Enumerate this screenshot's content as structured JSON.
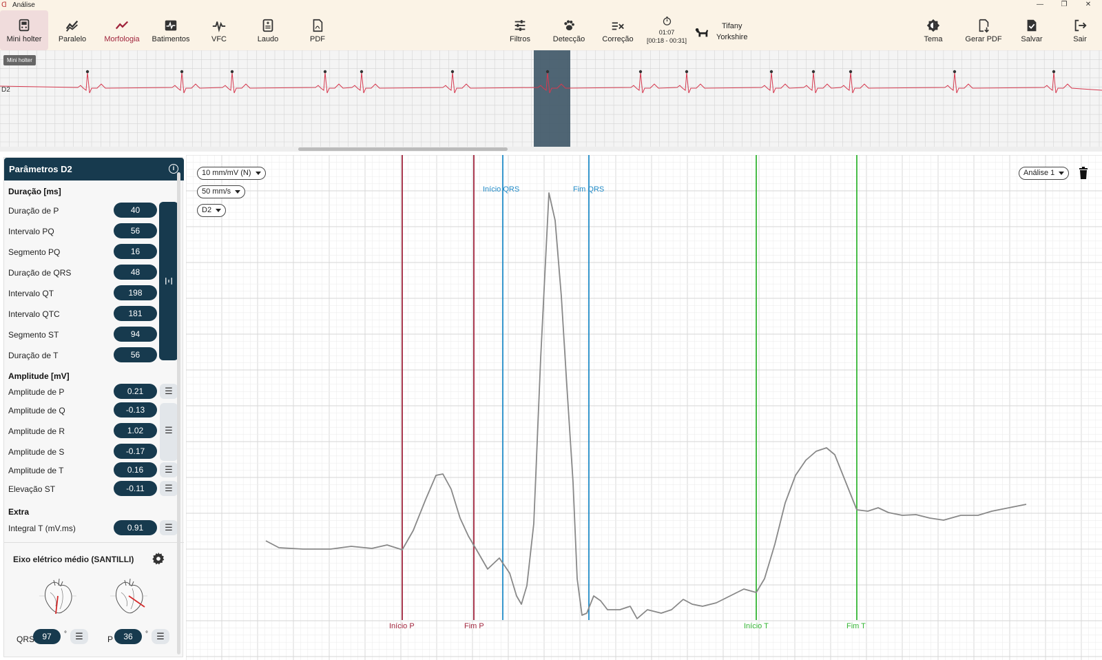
{
  "window": {
    "title": "Análise"
  },
  "toolbar": {
    "left": [
      {
        "label": "Mini holter",
        "icon": "mini-holter-icon"
      },
      {
        "label": "Paralelo",
        "icon": "paralelo-icon"
      },
      {
        "label": "Morfologia",
        "icon": "morfologia-icon"
      },
      {
        "label": "Batimentos",
        "icon": "batimentos-icon"
      },
      {
        "label": "VFC",
        "icon": "vfc-icon"
      },
      {
        "label": "Laudo",
        "icon": "laudo-icon"
      },
      {
        "label": "PDF",
        "icon": "pdf-icon"
      }
    ],
    "center": [
      {
        "label": "Filtros",
        "icon": "filtros-icon"
      },
      {
        "label": "Detecção",
        "icon": "paw-icon"
      },
      {
        "label": "Correção",
        "icon": "correcao-icon"
      }
    ],
    "time": {
      "current": "01:07",
      "range": "[00:18 - 00:31]"
    },
    "patient": {
      "name": "Tifany",
      "breed": "Yorkshire"
    },
    "right": [
      {
        "label": "Tema",
        "icon": "tema-icon"
      },
      {
        "label": "Gerar PDF",
        "icon": "gerar-pdf-icon"
      },
      {
        "label": "Salvar",
        "icon": "salvar-icon"
      },
      {
        "label": "Sair",
        "icon": "sair-icon"
      }
    ]
  },
  "strip": {
    "badge": "Mini holter",
    "lead": "D2"
  },
  "panel": {
    "title": "Parâmetros D2",
    "duracao": {
      "title": "Duração [ms]",
      "rows": [
        {
          "label": "Duração de P",
          "value": "40"
        },
        {
          "label": "Intervalo PQ",
          "value": "56"
        },
        {
          "label": "Segmento PQ",
          "value": "16"
        },
        {
          "label": "Duração de QRS",
          "value": "48"
        },
        {
          "label": "Intervalo QT",
          "value": "198"
        },
        {
          "label": "Intervalo QTC",
          "value": "181"
        },
        {
          "label": "Segmento ST",
          "value": "94"
        },
        {
          "label": "Duração de T",
          "value": "56"
        }
      ]
    },
    "amplitude": {
      "title": "Amplitude [mV]",
      "rows": [
        {
          "label": "Amplitude de P",
          "value": "0.21"
        },
        {
          "label": "Amplitude de Q",
          "value": "-0.13"
        },
        {
          "label": "Amplitude de R",
          "value": "1.02"
        },
        {
          "label": "Amplitude de S",
          "value": "-0.17"
        },
        {
          "label": "Amplitude de T",
          "value": "0.16"
        },
        {
          "label": "Elevação ST",
          "value": "-0.11"
        }
      ]
    },
    "extra": {
      "title": "Extra",
      "rows": [
        {
          "label": "Integral T (mV.ms)",
          "value": "0.91"
        }
      ]
    },
    "eixo": {
      "title": "Eixo elétrico médio (SANTILLI)",
      "qrs_label": "QRS",
      "qrs_value": "97",
      "p_label": "P",
      "p_value": "36",
      "deg": "°"
    }
  },
  "main": {
    "dropdowns": {
      "gain": "10 mm/mV (N)",
      "speed": "50 mm/s",
      "lead": "D2"
    },
    "analysis": "Análise 1",
    "markers": {
      "inicio_p": "Início P",
      "fim_p": "Fim P",
      "inicio_qrs": "Início QRS",
      "fim_qrs": "Fim QRS",
      "inicio_t": "Início T",
      "fim_t": "Fim T"
    },
    "colors": {
      "p": "#a0243c",
      "qrs": "#1f8ac7",
      "t": "#33b533",
      "trace": "#888888"
    }
  }
}
